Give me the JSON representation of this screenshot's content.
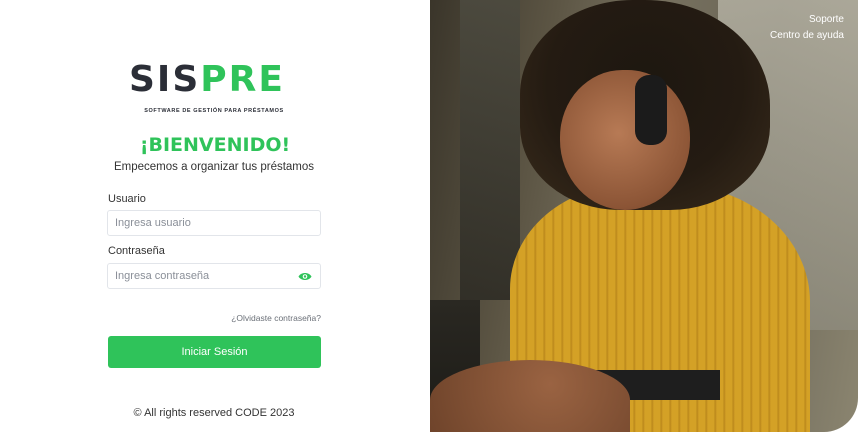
{
  "logo": {
    "word_part1": "SIS",
    "word_part2": "PRE",
    "tagline": "SOFTWARE DE GESTIÓN PARA PRÉSTAMOS"
  },
  "login": {
    "title": "¡BIENVENIDO!",
    "subtitle": "Empecemos a organizar tus préstamos",
    "username_label": "Usuario",
    "username_placeholder": "Ingresa usuario",
    "password_label": "Contraseña",
    "password_placeholder": "Ingresa contraseña",
    "forgot_link": "¿Olvidaste contraseña?",
    "submit_label": "Iniciar Sesión",
    "footer": "© All rights reserved CODE 2023"
  },
  "top_links": {
    "support": "Soporte",
    "help_center": "Centro de ayuda"
  },
  "icons": {
    "password_toggle": "eye-icon"
  },
  "colors": {
    "accent": "#2fc35a",
    "logo_dark": "#2b2e37"
  }
}
